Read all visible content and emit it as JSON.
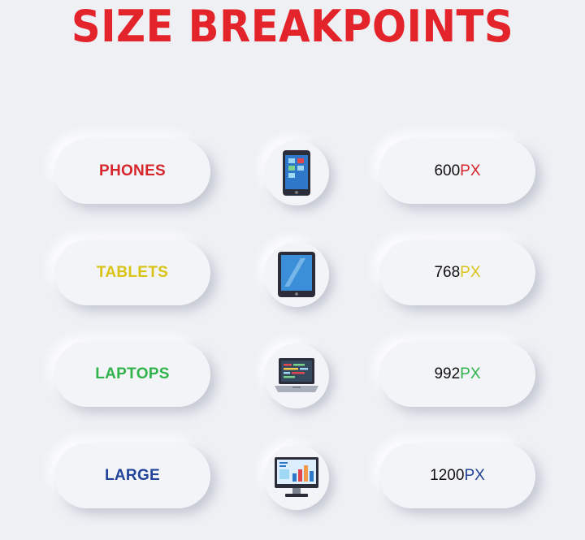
{
  "title": "SIZE BREAKPOINTS",
  "rows": [
    {
      "label": "PHONES",
      "value": "600",
      "unit": "PX",
      "color": "#d6262c",
      "icon": "phone-icon"
    },
    {
      "label": "TABLETS",
      "value": "768",
      "unit": "PX",
      "color": "#d9c315",
      "icon": "tablet-icon"
    },
    {
      "label": "LAPTOPS",
      "value": "992",
      "unit": "PX",
      "color": "#2fb34a",
      "icon": "laptop-icon"
    },
    {
      "label": "LARGE",
      "value": "1200",
      "unit": "PX",
      "color": "#22449a",
      "icon": "desktop-monitor-icon"
    }
  ]
}
